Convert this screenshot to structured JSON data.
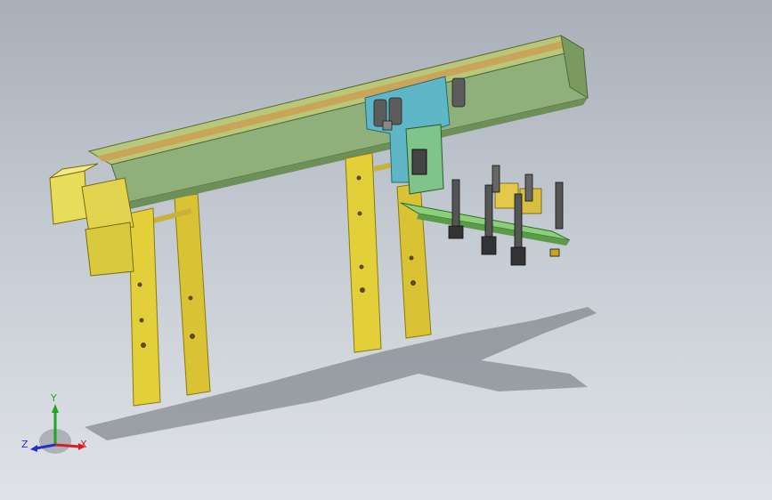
{
  "viewport": {
    "background_top": "#a9afb8",
    "background_bottom": "#dfe3e8"
  },
  "model": {
    "beam_color": "#8fb07a",
    "beam_stripe_color": "#c9a55a",
    "leg_color": "#e3cf3a",
    "motor_color": "#e7dd5b",
    "carriage_color": "#5fb6c6",
    "rail_color": "#8ccf7a"
  },
  "triad": {
    "x_label": "X",
    "y_label": "Y",
    "z_label": "Z",
    "x_color": "#d62020",
    "y_color": "#1fa51f",
    "z_color": "#2030c8"
  }
}
